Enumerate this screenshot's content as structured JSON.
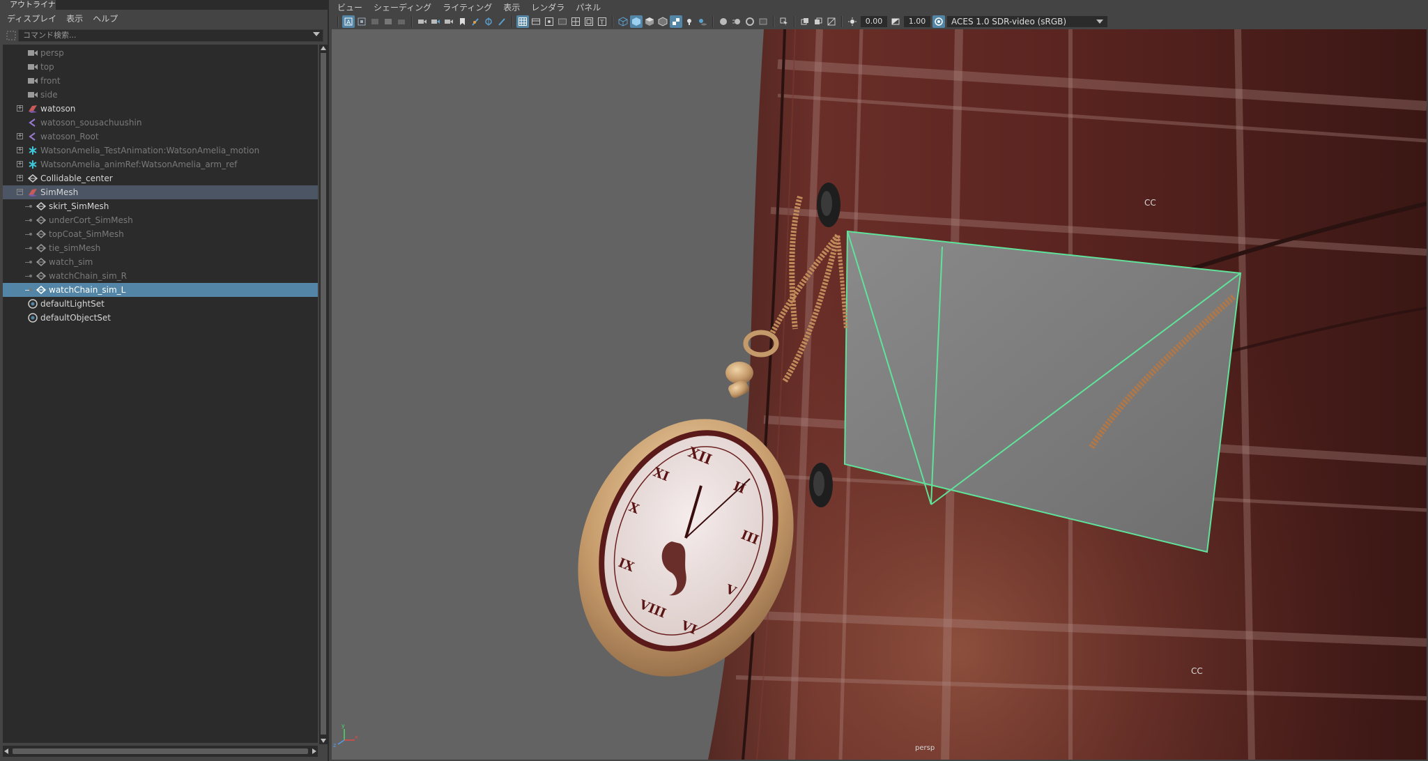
{
  "outliner": {
    "tab_title": "アウトライナ",
    "menu": [
      "ディスプレイ",
      "表示",
      "ヘルプ"
    ],
    "search_placeholder": "コマンド検索...",
    "items": [
      {
        "label": "persp",
        "type": "camera"
      },
      {
        "label": "top",
        "type": "camera"
      },
      {
        "label": "front",
        "type": "camera"
      },
      {
        "label": "side",
        "type": "camera"
      },
      {
        "label": "watoson",
        "type": "transform"
      },
      {
        "label": "watoson_sousachuushin",
        "type": "joint"
      },
      {
        "label": "watoson_Root",
        "type": "joint"
      },
      {
        "label": "WatsonAmelia_TestAnimation:WatsonAmelia_motion",
        "type": "anim"
      },
      {
        "label": "WatsonAmelia_animRef:WatsonAmelia_arm_ref",
        "type": "anim"
      },
      {
        "label": "Collidable_center",
        "type": "mesh"
      },
      {
        "label": "SimMesh",
        "type": "transform"
      },
      {
        "label": "skirt_SimMesh",
        "type": "mesh"
      },
      {
        "label": "underCort_SimMesh",
        "type": "mesh"
      },
      {
        "label": "topCoat_SimMesh",
        "type": "mesh"
      },
      {
        "label": "tie_simMesh",
        "type": "mesh"
      },
      {
        "label": "watch_sim",
        "type": "mesh"
      },
      {
        "label": "watchChain_sim_R",
        "type": "mesh"
      },
      {
        "label": "watchChain_sim_L",
        "type": "mesh"
      },
      {
        "label": "defaultLightSet",
        "type": "set"
      },
      {
        "label": "defaultObjectSet",
        "type": "set"
      }
    ]
  },
  "viewport": {
    "menu": [
      "ビュー",
      "シェーディング",
      "ライティング",
      "表示",
      "レンダラ",
      "パネル"
    ],
    "exposure_value": "0.00",
    "gamma_value": "1.00",
    "color_space": "ACES 1.0 SDR-video (sRGB)",
    "camera_label": "persp",
    "cc_label_1": "CC",
    "cc_label_2": "CC"
  },
  "colors": {
    "selection": "#5285a6",
    "wireframe_highlight": "#5fe39a",
    "background": "#444444"
  }
}
